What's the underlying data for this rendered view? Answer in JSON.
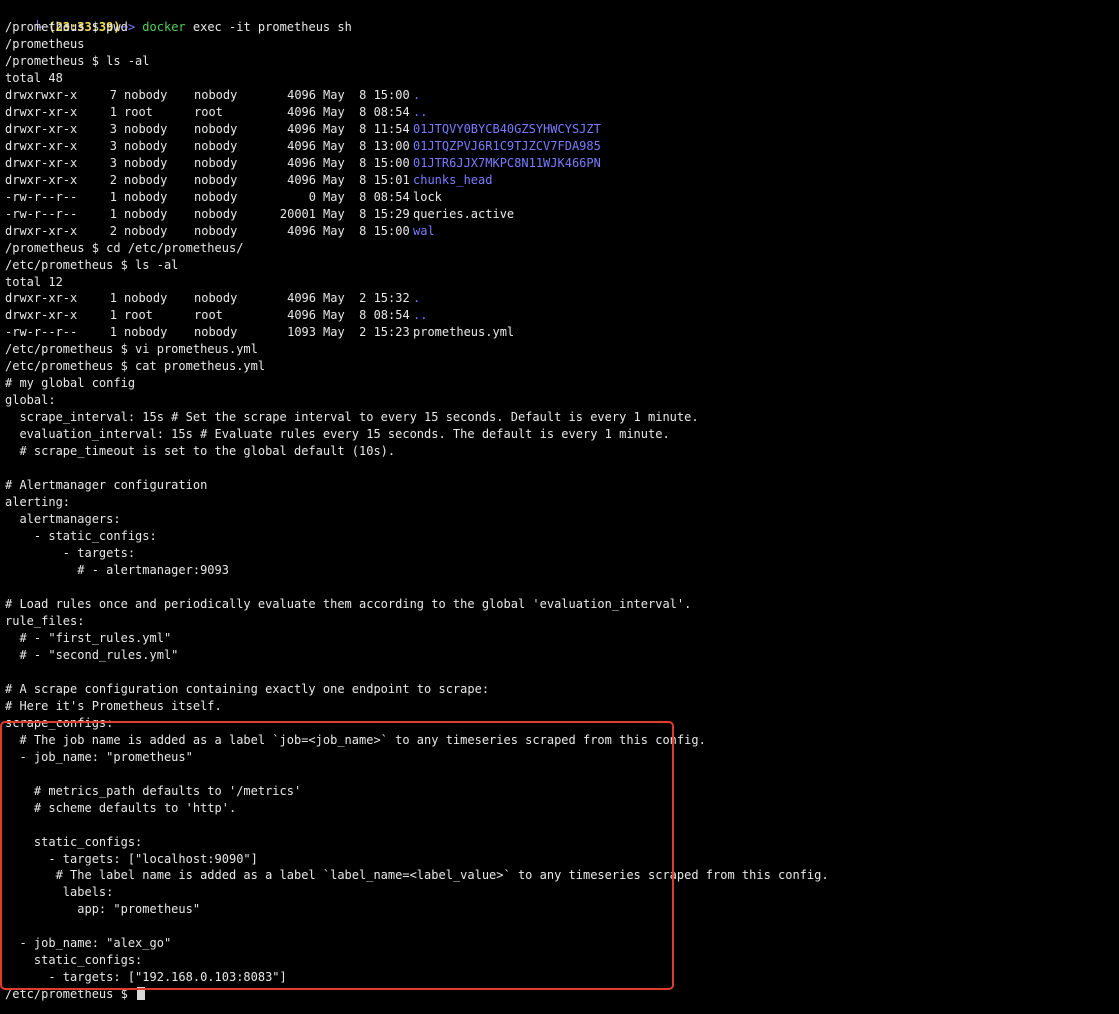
{
  "terminal": {
    "prompt_top": {
      "corner": "└─",
      "time": "(23:33:39)",
      "arrow": "─>",
      "command_word": "docker",
      "command_rest": " exec -it prometheus sh"
    },
    "lines_before_ls": [
      "/prometheus $ pwd",
      "/prometheus",
      "/prometheus $ ls -al",
      "total 48"
    ],
    "ls_prometheus": [
      {
        "perm": "drwxrwxr-x",
        "links": "7",
        "owner": "nobody",
        "group": "nobody",
        "size": "4096",
        "date": "May  8 15:00",
        "name": ".",
        "dir": true
      },
      {
        "perm": "drwxr-xr-x",
        "links": "1",
        "owner": "root",
        "group": "root",
        "size": "4096",
        "date": "May  8 08:54",
        "name": "..",
        "dir": true
      },
      {
        "perm": "drwxr-xr-x",
        "links": "3",
        "owner": "nobody",
        "group": "nobody",
        "size": "4096",
        "date": "May  8 11:54",
        "name": "01JTQVY0BYCB40GZSYHWCYSJZT",
        "dir": true
      },
      {
        "perm": "drwxr-xr-x",
        "links": "3",
        "owner": "nobody",
        "group": "nobody",
        "size": "4096",
        "date": "May  8 13:00",
        "name": "01JTQZPVJ6R1C9TJZCV7FDA985",
        "dir": true
      },
      {
        "perm": "drwxr-xr-x",
        "links": "3",
        "owner": "nobody",
        "group": "nobody",
        "size": "4096",
        "date": "May  8 15:00",
        "name": "01JTR6JJX7MKPC8N11WJK466PN",
        "dir": true
      },
      {
        "perm": "drwxr-xr-x",
        "links": "2",
        "owner": "nobody",
        "group": "nobody",
        "size": "4096",
        "date": "May  8 15:01",
        "name": "chunks_head",
        "dir": true
      },
      {
        "perm": "-rw-r--r--",
        "links": "1",
        "owner": "nobody",
        "group": "nobody",
        "size": "0",
        "date": "May  8 08:54",
        "name": "lock",
        "dir": false
      },
      {
        "perm": "-rw-r--r--",
        "links": "1",
        "owner": "nobody",
        "group": "nobody",
        "size": "20001",
        "date": "May  8 15:29",
        "name": "queries.active",
        "dir": false
      },
      {
        "perm": "drwxr-xr-x",
        "links": "2",
        "owner": "nobody",
        "group": "nobody",
        "size": "4096",
        "date": "May  8 15:00",
        "name": "wal",
        "dir": true
      }
    ],
    "lines_between": [
      "/prometheus $ cd /etc/prometheus/",
      "/etc/prometheus $ ls -al",
      "total 12"
    ],
    "ls_etc": [
      {
        "perm": "drwxr-xr-x",
        "links": "1",
        "owner": "nobody",
        "group": "nobody",
        "size": "4096",
        "date": "May  2 15:32",
        "name": ".",
        "dir": true
      },
      {
        "perm": "drwxr-xr-x",
        "links": "1",
        "owner": "root",
        "group": "root",
        "size": "4096",
        "date": "May  8 08:54",
        "name": "..",
        "dir": true
      },
      {
        "perm": "-rw-r--r--",
        "links": "1",
        "owner": "nobody",
        "group": "nobody",
        "size": "1093",
        "date": "May  2 15:23",
        "name": "prometheus.yml",
        "dir": false
      }
    ],
    "config_lines": [
      "/etc/prometheus $ vi prometheus.yml",
      "/etc/prometheus $ cat prometheus.yml",
      "# my global config",
      "global:",
      "  scrape_interval: 15s # Set the scrape interval to every 15 seconds. Default is every 1 minute.",
      "  evaluation_interval: 15s # Evaluate rules every 15 seconds. The default is every 1 minute.",
      "  # scrape_timeout is set to the global default (10s).",
      "",
      "# Alertmanager configuration",
      "alerting:",
      "  alertmanagers:",
      "    - static_configs:",
      "        - targets:",
      "          # - alertmanager:9093",
      "",
      "# Load rules once and periodically evaluate them according to the global 'evaluation_interval'.",
      "rule_files:",
      "  # - \"first_rules.yml\"",
      "  # - \"second_rules.yml\"",
      "",
      "# A scrape configuration containing exactly one endpoint to scrape:",
      "# Here it's Prometheus itself.",
      "scrape_configs:",
      "  # The job name is added as a label `job=<job_name>` to any timeseries scraped from this config.",
      "  - job_name: \"prometheus\"",
      "",
      "    # metrics_path defaults to '/metrics'",
      "    # scheme defaults to 'http'.",
      "",
      "    static_configs:",
      "      - targets: [\"localhost:9090\"]",
      "       # The label name is added as a label `label_name=<label_value>` to any timeseries scraped from this config.",
      "        labels:",
      "          app: \"prometheus\"",
      "",
      "  - job_name: \"alex_go\"",
      "    static_configs:",
      "      - targets: [\"192.168.0.103:8083\"]"
    ],
    "final_prompt": "/etc/prometheus $ "
  },
  "colors": {
    "background": "#000000",
    "text": "#e8e8e8",
    "directory": "#7b7bff",
    "command_green": "#4fd05a",
    "time_yellow": "#f2e052",
    "highlight_box": "#e23b2b"
  }
}
